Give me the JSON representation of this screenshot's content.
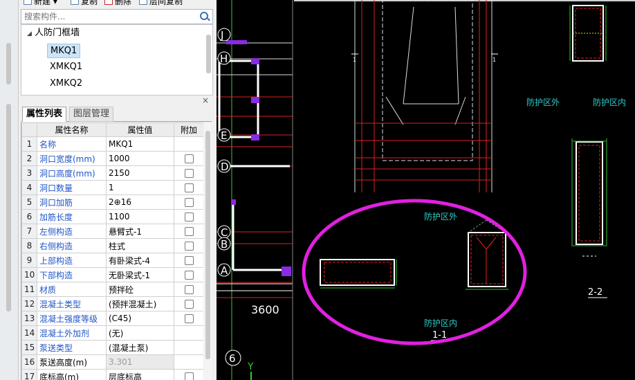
{
  "toolbar": {
    "new_label": "新建",
    "copy_label": "复制",
    "delete_label": "删除",
    "floor_copy_label": "层间复制"
  },
  "search": {
    "placeholder": "搜索构件..."
  },
  "tree": {
    "group": "人防门框墙",
    "items": [
      "MKQ1",
      "XMKQ1",
      "XMKQ2"
    ],
    "selected": "MKQ1"
  },
  "panel": {
    "close_label": "×",
    "tabs": [
      "属性列表",
      "图层管理"
    ]
  },
  "property_table": {
    "headers": [
      "属性名称",
      "属性值",
      "附加"
    ],
    "rows": [
      {
        "num": "1",
        "name": "名称",
        "value": "MKQ1",
        "blue": true,
        "checkbox": false
      },
      {
        "num": "2",
        "name": "洞口宽度(mm)",
        "value": "1000",
        "blue": true,
        "checkbox": true
      },
      {
        "num": "3",
        "name": "洞口高度(mm)",
        "value": "2150",
        "blue": true,
        "checkbox": true
      },
      {
        "num": "4",
        "name": "洞口数量",
        "value": "1",
        "blue": true,
        "checkbox": true
      },
      {
        "num": "5",
        "name": "洞口加筋",
        "value": "2⊕16",
        "blue": true,
        "checkbox": true
      },
      {
        "num": "6",
        "name": "加筋长度",
        "value": "1100",
        "blue": true,
        "checkbox": true
      },
      {
        "num": "7",
        "name": "左侧构造",
        "value": "悬臂式-1",
        "blue": true,
        "checkbox": true
      },
      {
        "num": "8",
        "name": "右侧构造",
        "value": "柱式",
        "blue": true,
        "checkbox": true
      },
      {
        "num": "9",
        "name": "上部构造",
        "value": "有卧梁式-4",
        "blue": true,
        "checkbox": true
      },
      {
        "num": "10",
        "name": "下部构造",
        "value": "无卧梁式-1",
        "blue": true,
        "checkbox": true
      },
      {
        "num": "11",
        "name": "材质",
        "value": "预拌砼",
        "blue": true,
        "checkbox": true
      },
      {
        "num": "12",
        "name": "混凝土类型",
        "value": "(预拌混凝土)",
        "blue": true,
        "checkbox": true
      },
      {
        "num": "13",
        "name": "混凝土强度等级",
        "value": "(C45)",
        "blue": true,
        "checkbox": true
      },
      {
        "num": "14",
        "name": "混凝土外加剂",
        "value": "(无)",
        "blue": true,
        "checkbox": false
      },
      {
        "num": "15",
        "name": "泵送类型",
        "value": "(混凝土泵)",
        "blue": true,
        "checkbox": false
      },
      {
        "num": "16",
        "name": "泵送高度(m)",
        "value": "3.301",
        "blue": false,
        "checkbox": false,
        "gray": true
      },
      {
        "num": "17",
        "name": "底标高(m)",
        "value": "层底标高",
        "blue": false,
        "checkbox": true
      }
    ]
  },
  "cad": {
    "axis_labels": [
      "J",
      "H",
      "E",
      "D",
      "C",
      "B",
      "A",
      "6"
    ],
    "dimension": "3600",
    "axis_y": "Y",
    "zone_outside": "防护区外",
    "zone_inside": "防护区内",
    "section_1": "1-1",
    "section_2": "2-2",
    "section_mark": "1",
    "highlight_color": "#e020e0"
  }
}
